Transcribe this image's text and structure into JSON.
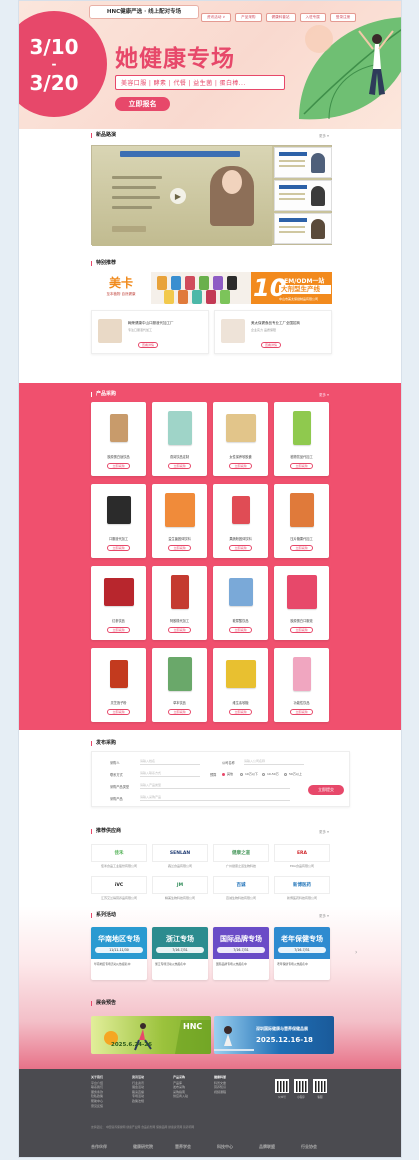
{
  "hero": {
    "top_label": "HNC健康严选 · 线上配对专场",
    "nav": [
      "资讯活动 ∨",
      "产品采购",
      "健康科普站",
      "入驻专属",
      "登录注册"
    ],
    "date_start": "3/10",
    "date_dash": "-",
    "date_end": "3/20",
    "title": "她健康专场",
    "tags": "美容口服 | 酵素 | 代餐 | 益生菌 | 蛋白棒...",
    "cta": "立即报名"
  },
  "live": {
    "title": "新品路演",
    "more": "更多 ▾",
    "banner": "新一届展会路演",
    "play_icon": "▶"
  },
  "special": {
    "title": "特别推荐",
    "more": "",
    "banner": {
      "brand": "美卡",
      "brand_sub": "至本植物 自然健康",
      "oem_text": "OEM/ODM一站式服务",
      "big_text": "大剂型生产线",
      "big_number": "10",
      "company": "中山市美太保健制品有限公司"
    },
    "cards": [
      {
        "name": "翰荣健康中山口服液代加工厂",
        "sub": "专注口服液代加工",
        "btn": "查看详情"
      },
      {
        "name": "美太保健食品专业工厂全国招商",
        "sub": "企业实力 品质保障",
        "btn": "查看详情"
      }
    ]
  },
  "products": {
    "title": "产品采购",
    "more": "更多 ▾",
    "btn_label": "立即采购",
    "items": [
      {
        "name": "胶原蛋白肽饮品",
        "color": "#c89b6b"
      },
      {
        "name": "燕窝饮品定制",
        "color": "#9fd4c8"
      },
      {
        "name": "女性保养软胶囊",
        "color": "#e2c58a"
      },
      {
        "name": "植物饮品代加工",
        "color": "#8fc94e"
      },
      {
        "name": "口服液代加工",
        "color": "#2b2b2b"
      },
      {
        "name": "益生菌固体饮料",
        "color": "#f08b3a"
      },
      {
        "name": "果蔬粉固体饮料",
        "color": "#e04c55"
      },
      {
        "name": "压片糖果代加工",
        "color": "#e07a3a"
      },
      {
        "name": "红参饮品",
        "color": "#b8262d"
      },
      {
        "name": "阿胶糕代加工",
        "color": "#c43a30"
      },
      {
        "name": "玻尿酸饮品",
        "color": "#7aa9d8"
      },
      {
        "name": "胶原蛋白口服液",
        "color": "#e7486a"
      },
      {
        "name": "灵芝孢子粉",
        "color": "#c33a1e"
      },
      {
        "name": "草本饮品",
        "color": "#6aa86a"
      },
      {
        "name": "维生素软糖",
        "color": "#e8c030"
      },
      {
        "name": "功能性饮品",
        "color": "#f0a6c0"
      }
    ]
  },
  "purchase": {
    "title": "发布采购",
    "labels": {
      "name": "采购人",
      "contact": "联系方式",
      "product": "采购产品",
      "company": "公司名称",
      "budget": "预算",
      "category": "采购产品类型"
    },
    "placeholders": {
      "name": "请输入姓名",
      "contact": "请输入联系方式",
      "product": "请输入采购产品",
      "company": "请输入公司名称",
      "category": "请输入产品类型"
    },
    "radios": [
      "其他",
      "10万以下",
      "10-50万",
      "50万以上"
    ],
    "submit": "立即提交"
  },
  "suppliers": {
    "title": "推荐供应商",
    "more": "更多 ▾",
    "items": [
      {
        "logo": "佳禾",
        "color": "#4caf50",
        "name": "佳禾食品工业股份有限公司"
      },
      {
        "logo": "SENLAN",
        "color": "#1f3b73",
        "name": "森兰食品有限公司"
      },
      {
        "logo": "健康之道",
        "color": "#4c9a5f",
        "name": "广州健康之道生物科技"
      },
      {
        "logo": "ERA",
        "color": "#d0262a",
        "name": "ERA食品有限公司"
      },
      {
        "logo": "iVC",
        "color": "#222222",
        "name": "江苏艾兰得营养品有限公司"
      },
      {
        "logo": "JM",
        "color": "#2e8b57",
        "name": "精美生物科技有限公司"
      },
      {
        "logo": "百诚",
        "color": "#1e70b8",
        "name": "百诚生物科技有限公司"
      },
      {
        "logo": "新博医药",
        "color": "#2f7dbd",
        "name": "新博医药科技有限公司"
      }
    ]
  },
  "series": {
    "title": "系列活动",
    "more": "更多 ▾",
    "arrow": "›",
    "items": [
      {
        "title": "华南地区专场",
        "date": "11/11-11/30",
        "color": "#2a9ad1",
        "text": "华南地区专场活动火热报名中"
      },
      {
        "title": "浙江专场",
        "date": "7/16-7/31",
        "color": "#2c8c8f",
        "text": "浙江专场活动火热报名中"
      },
      {
        "title": "国际品牌专场",
        "date": "7/16-7/31",
        "color": "#6a4cc7",
        "text": "国际品牌专场火热报名中"
      },
      {
        "title": "老年保健专场",
        "date": "7/16-7/31",
        "color": "#2f8bd0",
        "text": "老年保健专场火热报名中"
      }
    ]
  },
  "exhibitions": {
    "title": "展会预告",
    "items": [
      {
        "title": "HNC",
        "date": "2025.6.24-26",
        "color": "#9bc23c"
      },
      {
        "title": "深圳国际健康与营养保健品展",
        "date": "2025.12.16-18",
        "color": "#1f6fb5"
      }
    ]
  },
  "footer": {
    "cols": [
      {
        "head": "关于我们",
        "items": [
          "平台介绍",
          "联系我们",
          "服务条款",
          "隐私政策",
          "帮助中心",
          "意见反馈"
        ]
      },
      {
        "head": "资讯活动",
        "items": [
          "行业资讯",
          "展会活动",
          "路演直播",
          "专场活动",
          "政策法规"
        ]
      },
      {
        "head": "产品采购",
        "items": [
          "产品库",
          "发布采购",
          "采购指南",
          "供应商入驻"
        ]
      },
      {
        "head": "健康科普",
        "items": [
          "科普文章",
          "营养知识",
          "视频课程"
        ]
      }
    ],
    "qr_labels": [
      "公众号",
      "小程序",
      "客服"
    ],
    "links": "友情链接：  中国营养保健网   健康产业网   食品商务网   保健品网   健康资讯网   营养师网",
    "logos": [
      "合作伙伴",
      "健康研究院",
      "营养学会",
      "科技中心",
      "品牌联盟",
      "行业协会"
    ]
  }
}
